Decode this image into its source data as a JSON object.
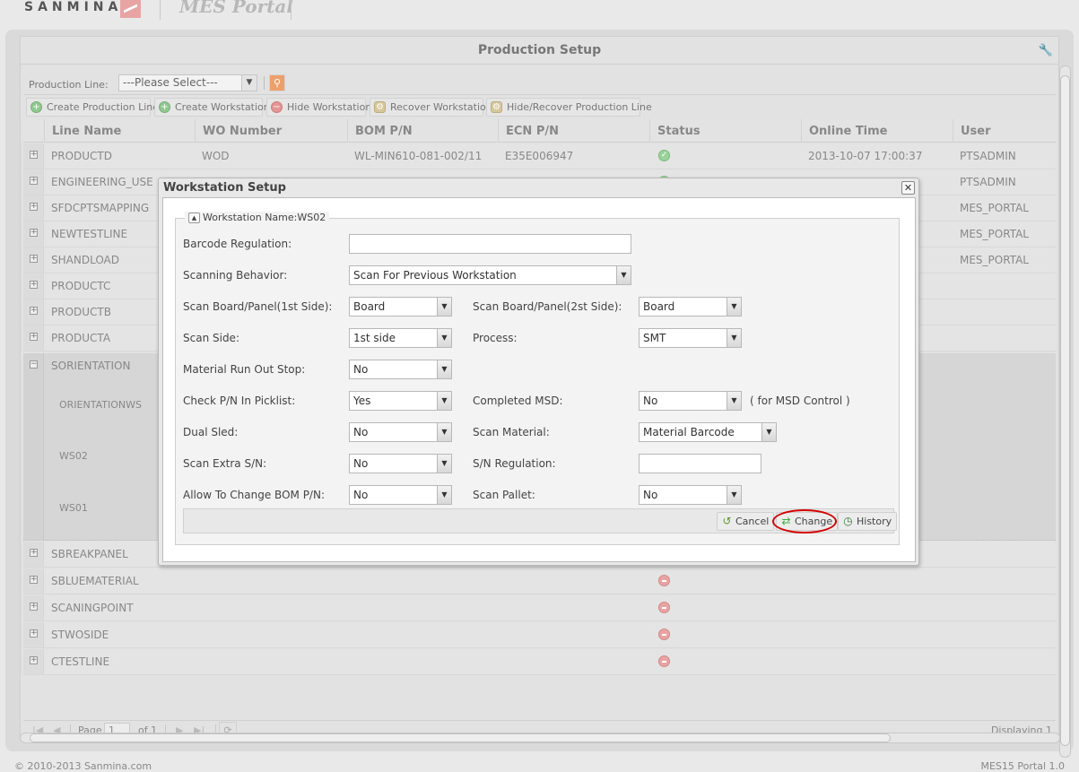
{
  "header": {
    "brand": "SANMINA",
    "portal_title": "MES Portal"
  },
  "panel": {
    "title": "Production Setup",
    "filter_label": "Production Line:",
    "filter_select_value": "---Please Select---"
  },
  "toolbar": {
    "create_line": "Create Production Line",
    "create_ws": "Create Workstation",
    "hide_ws": "Hide Workstation",
    "recover_ws": "Recover Workstation",
    "hide_recover_line": "Hide/Recover Production Line"
  },
  "grid": {
    "columns": [
      "Line Name",
      "WO Number",
      "BOM P/N",
      "ECN P/N",
      "Status",
      "Online Time",
      "User"
    ],
    "rows": [
      {
        "line": "PRODUCTD",
        "wo": "WOD",
        "bom": "WL-MIN610-081-002/11",
        "ecn": "E35E006947",
        "status": "active",
        "online": "2013-10-07 17:00:37",
        "user": "PTSADMIN"
      },
      {
        "line": "ENGINEERING_USE",
        "wo": "",
        "bom": "",
        "ecn": "",
        "status": "active",
        "online": "",
        "user": "PTSADMIN"
      },
      {
        "line": "SFDCPTSMAPPING",
        "wo": "",
        "bom": "",
        "ecn": "",
        "status": "",
        "online": "",
        "user": "MES_PORTAL"
      },
      {
        "line": "NEWTESTLINE",
        "wo": "",
        "bom": "",
        "ecn": "",
        "status": "",
        "online": "",
        "user": "MES_PORTAL"
      },
      {
        "line": "SHANDLOAD",
        "wo": "",
        "bom": "",
        "ecn": "",
        "status": "",
        "online": "",
        "user": "MES_PORTAL"
      },
      {
        "line": "PRODUCTC",
        "wo": "",
        "bom": "",
        "ecn": "",
        "status": "",
        "online": "",
        "user": ""
      },
      {
        "line": "PRODUCTB",
        "wo": "",
        "bom": "",
        "ecn": "",
        "status": "",
        "online": "",
        "user": ""
      },
      {
        "line": "PRODUCTA",
        "wo": "",
        "bom": "",
        "ecn": "",
        "status": "",
        "online": "",
        "user": ""
      }
    ],
    "expanded_group": {
      "line": "SORIENTATION",
      "workstations": [
        "ORIENTATIONWS",
        "WS02",
        "WS01"
      ]
    },
    "rows_after": [
      {
        "line": "SBREAKPANEL",
        "status": "inactive"
      },
      {
        "line": "SBLUEMATERIAL",
        "status": "inactive"
      },
      {
        "line": "SCANINGPOINT",
        "status": "inactive"
      },
      {
        "line": "STWOSIDE",
        "status": "inactive"
      },
      {
        "line": "CTESTLINE",
        "status": "inactive"
      }
    ]
  },
  "pager": {
    "page_label": "Page",
    "page_value": "1",
    "of_label": "of 1",
    "displaying": "Displaying 1"
  },
  "footer": {
    "copyright": "© 2010-2013 Sanmina.com",
    "version": "MES15 Portal 1.0"
  },
  "dialog": {
    "title": "Workstation Setup",
    "legend": "Workstation Name:WS02",
    "fields": {
      "barcode_regulation": {
        "label": "Barcode Regulation:",
        "value": ""
      },
      "scanning_behavior": {
        "label": "Scanning Behavior:",
        "value": "Scan For Previous Workstation"
      },
      "scan_board_1st": {
        "label": "Scan Board/Panel(1st Side):",
        "value": "Board"
      },
      "scan_board_2st": {
        "label": "Scan Board/Panel(2st Side):",
        "value": "Board"
      },
      "scan_side": {
        "label": "Scan Side:",
        "value": "1st side"
      },
      "process": {
        "label": "Process:",
        "value": "SMT"
      },
      "material_run_out_stop": {
        "label": "Material Run Out Stop:",
        "value": "No"
      },
      "check_pn_picklist": {
        "label": "Check P/N In Picklist:",
        "value": "Yes"
      },
      "completed_msd": {
        "label": "Completed MSD:",
        "value": "No",
        "note": "( for MSD Control )"
      },
      "dual_sled": {
        "label": "Dual Sled:",
        "value": "No"
      },
      "scan_material": {
        "label": "Scan Material:",
        "value": "Material Barcode"
      },
      "scan_extra_sn": {
        "label": "Scan Extra S/N:",
        "value": "No"
      },
      "sn_regulation": {
        "label": "S/N Regulation:",
        "value": ""
      },
      "allow_change_bom": {
        "label": "Allow To Change BOM P/N:",
        "value": "No"
      },
      "scan_pallet": {
        "label": "Scan Pallet:",
        "value": "No"
      }
    },
    "buttons": {
      "cancel": "Cancel",
      "change": "Change",
      "history": "History"
    },
    "highlight_color": "#d40000"
  }
}
